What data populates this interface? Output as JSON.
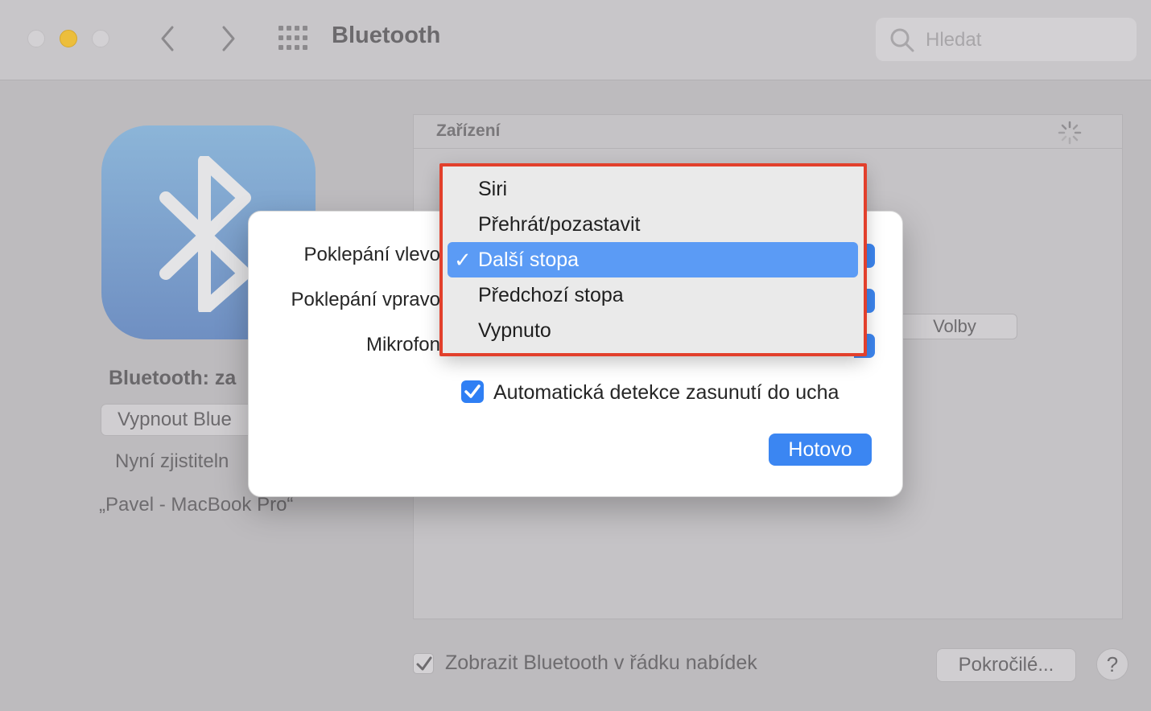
{
  "window": {
    "title": "Bluetooth",
    "search_placeholder": "Hledat",
    "icons": [
      "close-icon",
      "minimize-icon",
      "zoom-icon",
      "chevron-left-icon",
      "chevron-right-icon",
      "grid-icon",
      "search-icon"
    ]
  },
  "sidebar": {
    "status": "Bluetooth: za",
    "toggle_button": "Vypnout Blue",
    "discoverable_text": "Nyní zjistiteln",
    "computer_name": "„Pavel - MacBook Pro“"
  },
  "devices": {
    "header": "Zařízení",
    "options_button": "Volby"
  },
  "bottom": {
    "show_in_menu_bar": "Zobrazit Bluetooth v řádku nabídek",
    "show_in_menu_bar_checked": true,
    "advanced_button": "Pokročilé...",
    "help_button": "?"
  },
  "sheet": {
    "double_tap_left_label": "Poklepání vlevo",
    "double_tap_right_label": "Poklepání vpravo",
    "microphone_label": "Mikrofon",
    "auto_ear_detection_label": "Automatická detekce zasunutí do ucha",
    "auto_ear_detection_checked": true,
    "done_button": "Hotovo"
  },
  "menu": {
    "check_mark": "✓",
    "items": [
      {
        "label": "Siri",
        "selected": false
      },
      {
        "label": "Přehrát/pozastavit",
        "selected": false
      },
      {
        "label": "Další stopa",
        "selected": true
      },
      {
        "label": "Předchozí stopa",
        "selected": false
      },
      {
        "label": "Vypnuto",
        "selected": false
      }
    ],
    "highlight_color": "#e2402c"
  },
  "colors": {
    "accent": "#3b86f2",
    "menu_selection": "#5b9bf5"
  }
}
